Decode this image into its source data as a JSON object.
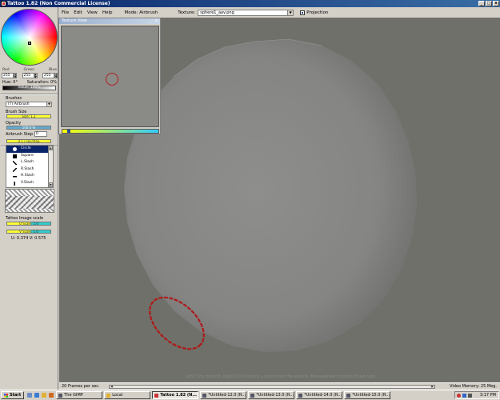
{
  "window": {
    "title": "Tattoo 1.82 (Non Commercial License)",
    "controls": [
      "_",
      "□",
      "x"
    ]
  },
  "menu": {
    "items": [
      "File",
      "Edit",
      "View",
      "Help"
    ],
    "mode_label": "Mode: Airbrush",
    "texture_label": "Texture:",
    "texture_value": "sphere1_aav.png",
    "projection_label": "Projection",
    "projection_checked": true
  },
  "color": {
    "labels": [
      "Red",
      "Green",
      "Blue"
    ],
    "red": "255",
    "green": "255",
    "blue": "255",
    "hue": "Hue: 0°",
    "saturation": "Saturation: 0%",
    "value": "Value: 100%"
  },
  "brushes": {
    "section": "Brushes",
    "selected": "(T) Airbrush",
    "size_label": "Brush Size",
    "size_value": "Size: 1.2",
    "opacity_label": "Opacity",
    "opacity_value": "100.0 %",
    "step_label": "Airbrush Step",
    "step_value": "0",
    "rate_value": "0.1 / sec/step",
    "list": [
      "Circle",
      "Square",
      "L.Slash",
      "R.Slash",
      "H.Slash",
      "V.Slash"
    ],
    "selected_index": 0
  },
  "image_scale": {
    "label": "Tattoo Image scale",
    "u_scale": "U Scale: 1.0",
    "v_scale": "V Scale: 1.0"
  },
  "uv_readout": "U: 0.374  V: 0.575",
  "texture_view": {
    "title": "Texture View",
    "buttons": "_ x"
  },
  "viewport": {
    "hint": "Left Click to paint, Right Click to pick a color from the texture. Mousewheel controls brush size."
  },
  "status": {
    "fps": "20 Frames per sec.",
    "video_memory": "Video Memory: 25 Meg."
  },
  "taskbar": {
    "start": "Start",
    "tasks": [
      {
        "label": "The GIMP",
        "active": false
      },
      {
        "label": "Local",
        "active": false
      },
      {
        "label": "Tattoo 1.82 (N...",
        "active": true
      },
      {
        "label": "*Untitled-12.0 (R...",
        "active": false
      },
      {
        "label": "*Untitled-13.0 (R...",
        "active": false
      },
      {
        "label": "*Untitled-14.0 (R...",
        "active": false
      },
      {
        "label": "*Untitled-15.0 (R...",
        "active": false
      }
    ],
    "clock": "3:17 PM"
  },
  "colors": {
    "viewport_bg": "#6f706a",
    "sphere": "#8c8c8a",
    "stroke": "#b01818",
    "titlebar": "#0a246a"
  }
}
